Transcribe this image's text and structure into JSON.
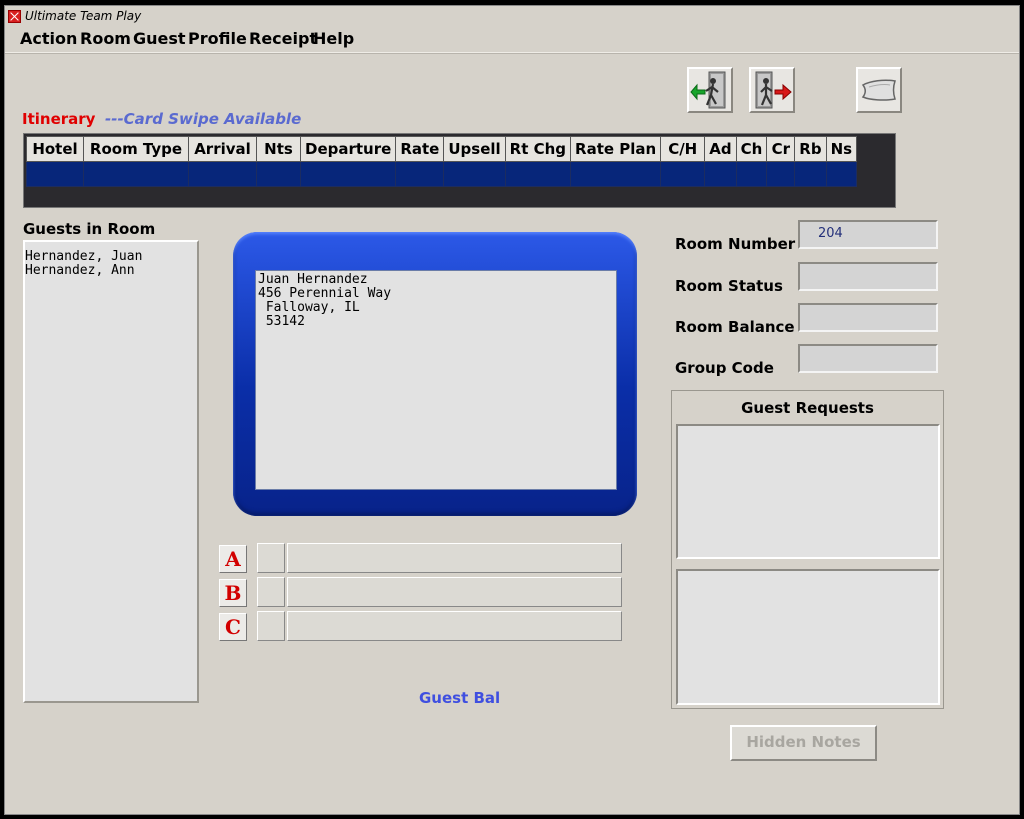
{
  "window": {
    "title": "Ultimate Team Play"
  },
  "menu": [
    "Action",
    "Room",
    "Guest",
    "Profile",
    "Receipt",
    "Help"
  ],
  "itinerary": {
    "label": "Itinerary",
    "card_swipe": "---Card Swipe Available",
    "columns": [
      "Hotel",
      "Room Type",
      "Arrival",
      "Nts",
      "Departure",
      "Rate",
      "Upsell",
      "Rt Chg",
      "Rate Plan",
      "C/H",
      "Ad",
      "Ch",
      "Cr",
      "Rb",
      "Ns"
    ]
  },
  "guests_in_room": {
    "label": "Guests in Room",
    "names": [
      "Hernandez, Juan",
      "Hernandez, Ann"
    ]
  },
  "address": [
    "Juan Hernandez",
    "456 Perennial Way",
    " Falloway, IL",
    " 53142"
  ],
  "notes": {
    "a": "A",
    "b": "B",
    "c": "C"
  },
  "room": {
    "number_label": "Room Number",
    "number_value": "204",
    "status_label": "Room Status",
    "status_value": "",
    "balance_label": "Room Balance",
    "balance_value": "",
    "group_label": "Group Code",
    "group_value": ""
  },
  "guest_requests": {
    "label": "Guest Requests"
  },
  "guest_bal": "Guest Bal",
  "hidden_notes": "Hidden Notes",
  "icons": {
    "check_in": "check-in-door-icon",
    "check_out": "check-out-door-icon",
    "pillow": "pillow-icon"
  },
  "colors": {
    "itinerary_red": "#e00000",
    "card_swipe_blue": "#5a6ad0",
    "grid_row_blue": "#07267a",
    "address_frame_blue": "#0a2ea8",
    "guest_bal_blue": "#3f4fe0"
  }
}
